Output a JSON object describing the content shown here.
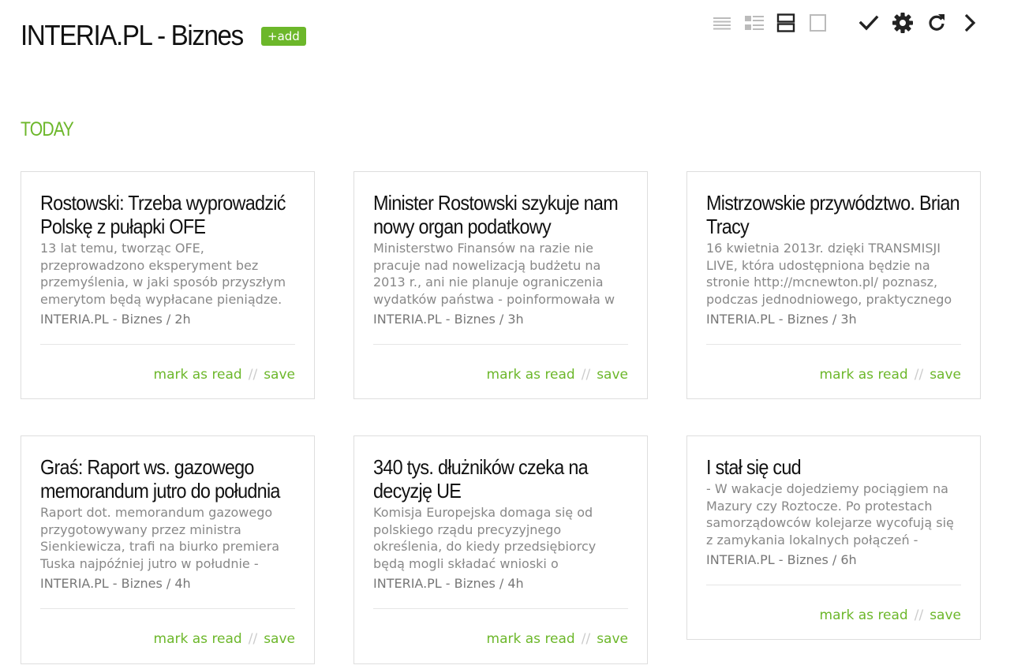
{
  "header": {
    "title": "INTERIA.PL - Biznes",
    "add_label": "+add",
    "toolbar": [
      {
        "icon": "list-view-icon"
      },
      {
        "icon": "summary-view-icon"
      },
      {
        "icon": "cards-view-icon"
      },
      {
        "icon": "full-view-icon"
      },
      {
        "icon": "checkmark-icon"
      },
      {
        "icon": "gear-icon"
      },
      {
        "icon": "refresh-icon"
      },
      {
        "icon": "chevron-right-icon"
      }
    ]
  },
  "section": {
    "title": "TODAY"
  },
  "actions": {
    "mark_read": "mark as read",
    "separator": "//",
    "save": "save"
  },
  "articles": [
    {
      "title": "Rostowski: Trzeba wyprowadzić Polskę z pułapki OFE",
      "summary": "13 lat temu, tworząc OFE, przeprowadzono eksperyment bez przemyślenia, w jaki sposób przyszłym emerytom będą wypłacane pieniądze.",
      "meta": "INTERIA.PL - Biznes / 2h"
    },
    {
      "title": "Minister Rostowski szykuje nam nowy organ podatkowy",
      "summary": "Ministerstwo Finansów na razie nie pracuje nad nowelizacją budżetu na 2013 r., ani nie planuje ograniczenia wydatków państwa - poinformowała w",
      "meta": "INTERIA.PL - Biznes / 3h"
    },
    {
      "title": "Mistrzowskie przywództwo. Brian Tracy",
      "summary": "16 kwietnia 2013r. dzięki TRANSMISJI LIVE, która udostępniona będzie na stronie http://mcnewton.pl/ poznasz, podczas jednodniowego, praktycznego",
      "meta": "INTERIA.PL - Biznes / 3h"
    },
    {
      "title": "Graś: Raport ws. gazowego memorandum jutro do południa",
      "summary": "Raport dot. memorandum gazowego przygotowywany przez ministra Sienkiewicza, trafi na biurko premiera Tuska najpóźniej jutro w południe -",
      "meta": "INTERIA.PL - Biznes / 4h"
    },
    {
      "title": "340 tys. dłużników czeka na decyzję UE",
      "summary": "Komisja Europejska domaga się od polskiego rządu precyzyjnego określenia, do kiedy przedsiębiorcy będą mogli składać wnioski o",
      "meta": "INTERIA.PL - Biznes / 4h"
    },
    {
      "title": "I stał się cud",
      "summary": "- W wakacje dojedziemy pociągiem na Mazury czy Roztocze. Po protestach samorządowców kolejarze wycofują się z zamykania lokalnych połączeń -",
      "meta": "INTERIA.PL - Biznes / 6h"
    }
  ]
}
